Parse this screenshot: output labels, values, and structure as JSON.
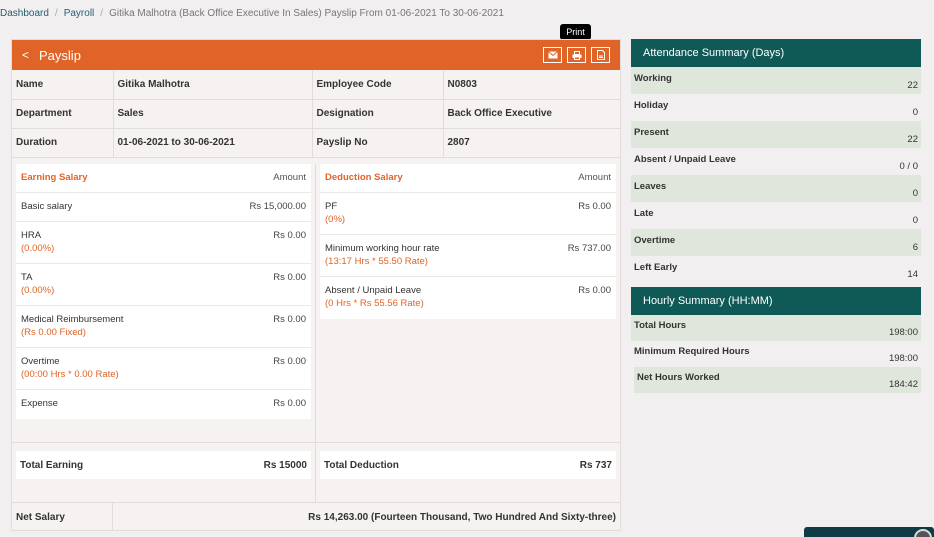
{
  "breadcrumb": {
    "items": [
      "Dashboard",
      "Payroll",
      "Gitika Malhotra (Back Office Executive In Sales) Payslip From 01-06-2021 To 30-06-2021"
    ]
  },
  "tooltip": "Print",
  "payslip": {
    "back_glyph": "<",
    "title": "Payslip",
    "actions": [
      "mail-icon",
      "print-icon",
      "pdf-icon"
    ],
    "info": {
      "name_label": "Name",
      "name": "Gitika Malhotra",
      "code_label": "Employee Code",
      "code": "N0803",
      "dept_label": "Department",
      "dept": "Sales",
      "desig_label": "Designation",
      "desig": "Back Office Executive",
      "duration_label": "Duration",
      "duration": "01-06-2021 to 30-06-2021",
      "slip_label": "Payslip No",
      "slip": "2807"
    },
    "earnings": {
      "header": "Earning Salary",
      "amount_header": "Amount",
      "rows": [
        {
          "label": "Basic salary",
          "sub": "",
          "amount": "Rs 15,000.00"
        },
        {
          "label": "HRA",
          "sub": "(0.00%)",
          "amount": "Rs 0.00"
        },
        {
          "label": "TA",
          "sub": "(0.00%)",
          "amount": "Rs 0.00"
        },
        {
          "label": "Medical Reimbursement",
          "sub": "(Rs 0.00 Fixed)",
          "amount": "Rs 0.00"
        },
        {
          "label": "Overtime",
          "sub": "(00:00 Hrs * 0.00 Rate)",
          "amount": "Rs 0.00"
        },
        {
          "label": "Expense",
          "sub": "",
          "amount": "Rs 0.00"
        }
      ],
      "total_label": "Total Earning",
      "total": "Rs 15000"
    },
    "deductions": {
      "header": "Deduction Salary",
      "amount_header": "Amount",
      "rows": [
        {
          "label": "PF",
          "sub": "(0%)",
          "amount": "Rs 0.00"
        },
        {
          "label": "Minimum working hour rate",
          "sub": "(13:17 Hrs * 55.50 Rate)",
          "amount": "Rs 737.00"
        },
        {
          "label": "Absent / Unpaid Leave",
          "sub": "(0 Hrs * Rs 55.56 Rate)",
          "amount": "Rs 0.00"
        }
      ],
      "total_label": "Total Deduction",
      "total": "Rs 737"
    },
    "net_label": "Net Salary",
    "net_value": "Rs 14,263.00 (Fourteen Thousand, Two Hundred And Sixty-three)"
  },
  "attendance": {
    "title": "Attendance Summary (Days)",
    "rows": [
      {
        "label": "Working",
        "value": "22"
      },
      {
        "label": "Holiday",
        "value": "0"
      },
      {
        "label": "Present",
        "value": "22"
      },
      {
        "label": "Absent / Unpaid Leave",
        "value": "0 / 0"
      },
      {
        "label": "Leaves",
        "value": "0"
      },
      {
        "label": "Late",
        "value": "0"
      },
      {
        "label": "Overtime",
        "value": "6"
      },
      {
        "label": "Left Early",
        "value": "14"
      }
    ]
  },
  "hourly": {
    "title": "Hourly Summary (HH:MM)",
    "rows": [
      {
        "label": "Total Hours",
        "value": "198:00"
      },
      {
        "label": "Minimum Required Hours",
        "value": "198:00"
      },
      {
        "label": "Net Hours Worked",
        "value": "184:42"
      }
    ]
  }
}
